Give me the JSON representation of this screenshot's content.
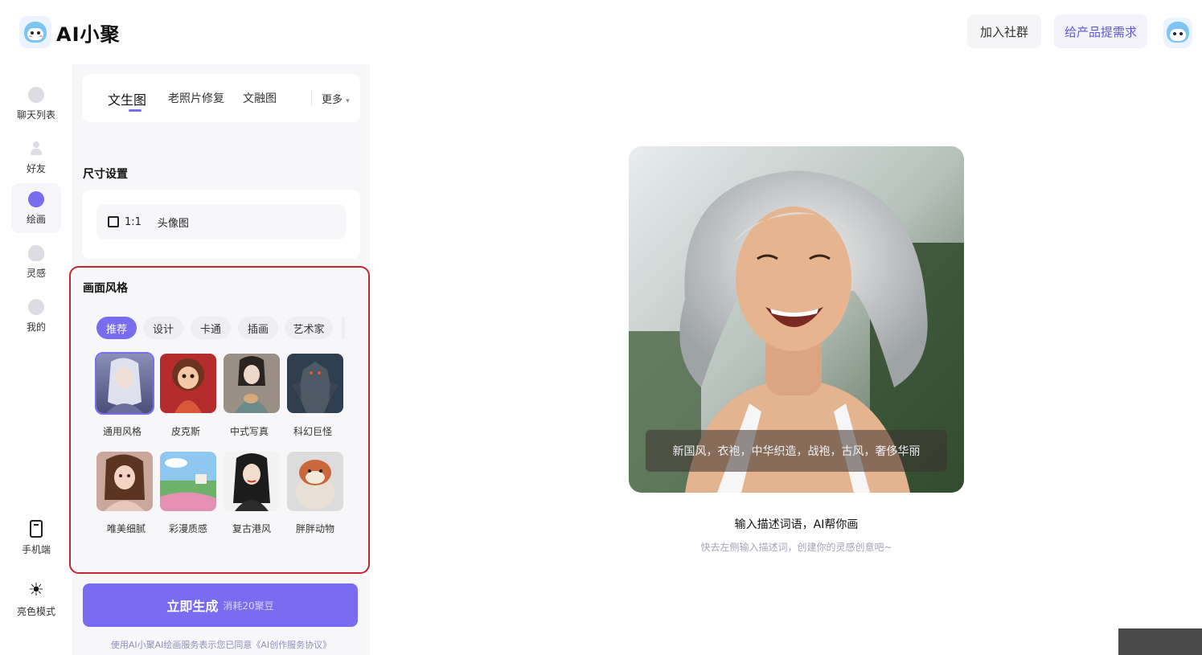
{
  "header": {
    "logo_text": "AI小聚",
    "community_button": "加入社群",
    "feedback_button": "给产品提需求"
  },
  "nav": {
    "items": [
      {
        "label": "聊天列表",
        "icon": "chat-bubble-icon"
      },
      {
        "label": "好友",
        "icon": "person-icon"
      },
      {
        "label": "绘画",
        "icon": "palette-icon"
      },
      {
        "label": "灵感",
        "icon": "lightbulb-icon"
      },
      {
        "label": "我的",
        "icon": "smile-icon"
      }
    ],
    "mobile": {
      "label": "手机端",
      "icon": "phone-icon"
    },
    "theme": {
      "label": "亮色模式",
      "icon": "sun-icon"
    }
  },
  "tabs": {
    "items": [
      "文生图",
      "老照片修复",
      "文融图"
    ],
    "more": "更多"
  },
  "size": {
    "title": "尺寸设置",
    "ratio": "1:1",
    "name": "头像图"
  },
  "style": {
    "title": "画面风格",
    "categories": [
      "推荐",
      "设计",
      "卡通",
      "插画",
      "艺术家"
    ],
    "thumbs": [
      "通用风格",
      "皮克斯",
      "中式写真",
      "科幻巨怪",
      "唯美细腻",
      "彩漫质感",
      "复古港风",
      "胖胖动物"
    ]
  },
  "generate": {
    "label": "立即生成",
    "cost": "消耗20聚豆"
  },
  "agreement": "使用AI小聚AI绘画服务表示您已同意《AI创作服务协议》",
  "preview": {
    "caption": "新国风，衣袍，中华织造，战袍，古风，奢侈华丽",
    "title": "输入描述词语，AI帮你画",
    "subtitle": "快去左侧输入描述词，创建你的灵感创意吧~"
  },
  "colors": {
    "accent": "#7a6cf0",
    "highlight_border": "#c1272d"
  }
}
